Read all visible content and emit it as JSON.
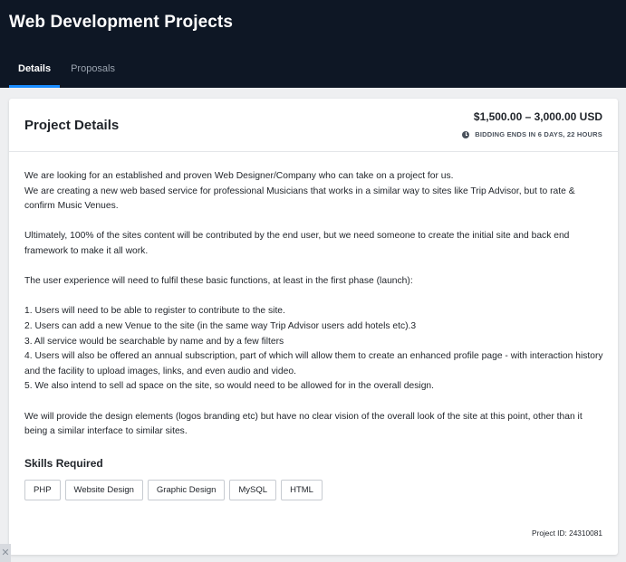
{
  "header": {
    "title": "Web Development Projects",
    "tabs": [
      {
        "label": "Details",
        "active": true
      },
      {
        "label": "Proposals",
        "active": false
      }
    ]
  },
  "card": {
    "title": "Project Details",
    "budget": "$1,500.00 – 3,000.00 USD",
    "bidding": "BIDDING ENDS IN 6 DAYS, 22 HOURS",
    "description": {
      "p1": "We are looking for an established and proven Web Designer/Company who can take on a project for us.",
      "p2": "We are creating a new web based service for professional Musicians that works in a similar way to sites like Trip Advisor, but to rate & confirm Music Venues.",
      "p3": "Ultimately, 100% of the sites content will be contributed by the end user, but we need someone to create the initial site and back end framework to make it all work.",
      "p4": "The user experience will need to fulfil these basic functions, at least in the first phase (launch):",
      "items": [
        "1. Users will need to be able to register to contribute to the site.",
        "2. Users can add a new Venue to the site (in the same way Trip Advisor users add hotels etc).3",
        "3. All service would be searchable by name and by a few filters",
        "4. Users will also be offered an annual subscription, part of which will allow them to create an enhanced profile page - with interaction history and the facility to upload images, links, and even audio and video.",
        "5. We also intend to sell ad space on the site, so would need to be allowed for in the overall design."
      ],
      "p5": "We will provide the design elements (logos branding etc) but have no clear vision of the overall look of the site at this point, other than it being a similar interface to similar sites."
    },
    "skills_title": "Skills Required",
    "skills": [
      "PHP",
      "Website Design",
      "Graphic Design",
      "MySQL",
      "HTML"
    ],
    "project_id": "Project ID: 24310081"
  },
  "colors": {
    "header_bg": "#0e1725",
    "tab_indicator": "#1a8cff",
    "page_bg": "#eeeff1"
  },
  "icons": {
    "bidding": "clock-icon",
    "corner": "close-icon"
  }
}
